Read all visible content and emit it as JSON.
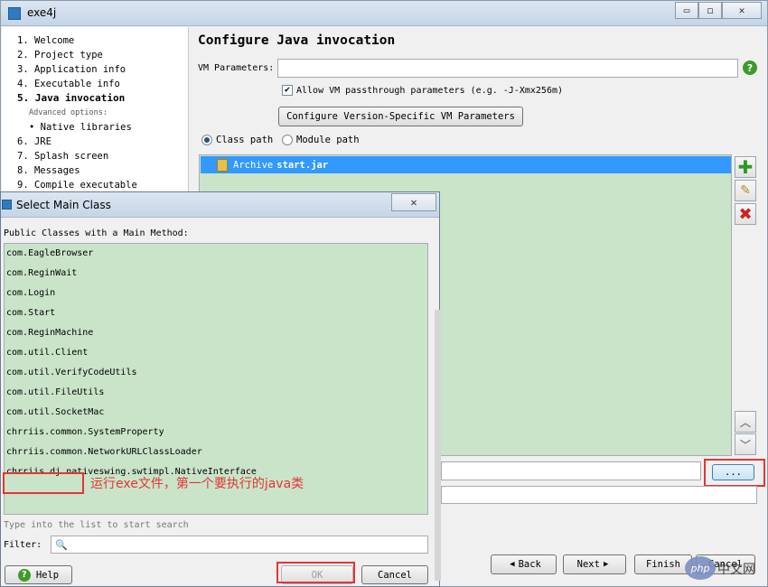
{
  "main_window": {
    "title": "exe4j",
    "controls": {
      "minimize": "▭",
      "maximize": "◻",
      "close": "✕"
    }
  },
  "nav": {
    "items": [
      {
        "number": "1.",
        "label": "Welcome"
      },
      {
        "number": "2.",
        "label": "Project type"
      },
      {
        "number": "3.",
        "label": "Application info"
      },
      {
        "number": "4.",
        "label": "Executable info"
      },
      {
        "number": "5.",
        "label": "Java invocation",
        "active": true
      },
      {
        "number": "6.",
        "label": "JRE"
      },
      {
        "number": "7.",
        "label": "Splash screen"
      },
      {
        "number": "8.",
        "label": "Messages"
      },
      {
        "number": "9.",
        "label": "Compile executable"
      }
    ],
    "advanced_header": "Advanced options:",
    "advanced_item": "• Native libraries"
  },
  "content": {
    "title": "Configure Java invocation",
    "vm_label": "VM Parameters:",
    "vm_value": "",
    "help_icon": "?",
    "passthrough_label": "Allow VM passthrough parameters (e.g. -J-Xmx256m)",
    "passthrough_checked": true,
    "version_button": "Configure Version-Specific VM Parameters",
    "radio_classpath": "Class path",
    "radio_modulepath": "Module path",
    "classpath_entry_prefix": "Archive",
    "classpath_entry_file": "start.jar",
    "browse_button": "...",
    "buttons": {
      "back": "Back",
      "next": "Next",
      "finish": "Finish",
      "cancel": "Cancel"
    }
  },
  "dialog": {
    "title": "Select Main Class",
    "close_icon": "✕",
    "label": "Public Classes with a Main Method:",
    "classes": [
      "com.EagleBrowser",
      "com.ReginWait",
      "com.Login",
      "com.Start",
      "com.ReginMachine",
      "com.util.Client",
      "com.util.VerifyCodeUtils",
      "com.util.FileUtils",
      "com.util.SocketMac",
      "chrriis.common.SystemProperty",
      "chrriis.common.NetworkURLClassLoader",
      "chrriis.dj.nativeswing.swtimpl.NativeInterface"
    ],
    "annotation": "运行exe文件，第一个要执行的java类",
    "search_hint": "Type into the list to start search",
    "filter_label": "Filter:",
    "filter_icon": "🔍",
    "buttons": {
      "help": "Help",
      "ok": "OK",
      "cancel": "Cancel"
    }
  },
  "watermark": {
    "logo": "php",
    "text": "中文网"
  },
  "colors": {
    "list_bg": "#c9e4c9",
    "selection": "#3399ff",
    "highlight_box": "#e53434"
  }
}
